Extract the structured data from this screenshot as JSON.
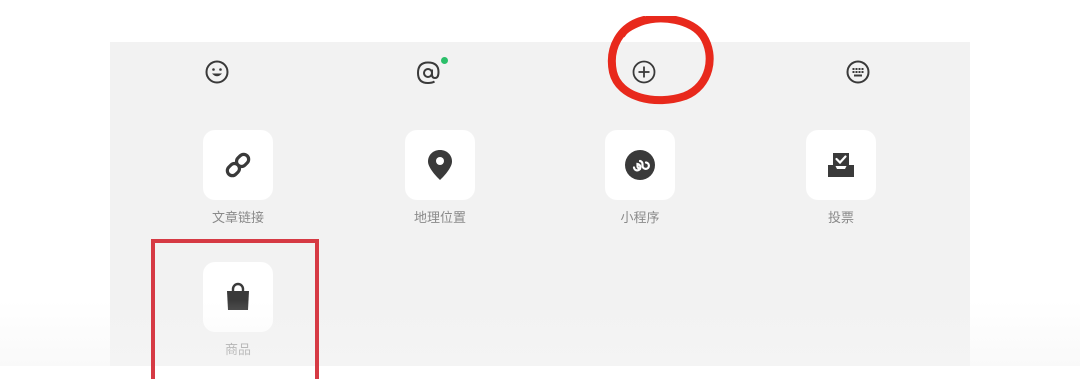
{
  "toolbar": {
    "icons": [
      {
        "name": "emoji-icon"
      },
      {
        "name": "mention-icon",
        "badge_color": "#2bbf6a"
      },
      {
        "name": "plus-circle-icon"
      },
      {
        "name": "keyboard-icon"
      }
    ]
  },
  "tiles": [
    {
      "label": "文章链接",
      "icon": "link-icon"
    },
    {
      "label": "地理位置",
      "icon": "location-pin-icon"
    },
    {
      "label": "小程序",
      "icon": "mini-program-icon"
    },
    {
      "label": "投票",
      "icon": "vote-icon"
    },
    {
      "label": "商品",
      "icon": "shopping-bag-icon"
    }
  ],
  "colors": {
    "panel_bg": "#f2f2f2",
    "icon": "#3a3a3a",
    "label": "#8a8a8a",
    "annotation_circle": "#e8291c",
    "annotation_rect": "#d63a44"
  }
}
